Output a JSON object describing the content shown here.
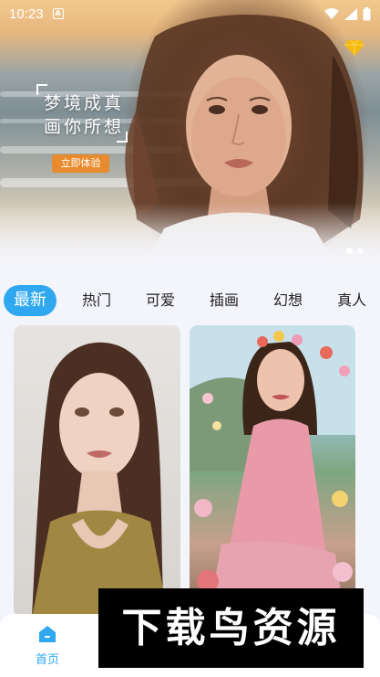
{
  "status_bar": {
    "time": "10:23",
    "notification_icon": "a-square-icon",
    "right_icons": [
      "wifi-icon",
      "signal-icon",
      "battery-icon"
    ]
  },
  "banner": {
    "slogan_line1": "梦境成真",
    "slogan_line2": "画你所想",
    "cta_label": "立即体验",
    "vip_icon": "diamond-icon",
    "slide_count": 2,
    "active_slide": 1
  },
  "tabs": [
    {
      "label": "最新",
      "active": true
    },
    {
      "label": "热门",
      "active": false
    },
    {
      "label": "可爱",
      "active": false
    },
    {
      "label": "插画",
      "active": false
    },
    {
      "label": "幻想",
      "active": false
    },
    {
      "label": "真人",
      "active": false
    }
  ],
  "bottom_nav": {
    "home_label": "首页",
    "home_icon": "home-icon"
  },
  "watermark": {
    "text": "下载鸟资源"
  },
  "colors": {
    "accent": "#2fa8f0",
    "cta": "#e88b2e",
    "background": "#f4f5fb",
    "vip": "#f6b90f"
  }
}
